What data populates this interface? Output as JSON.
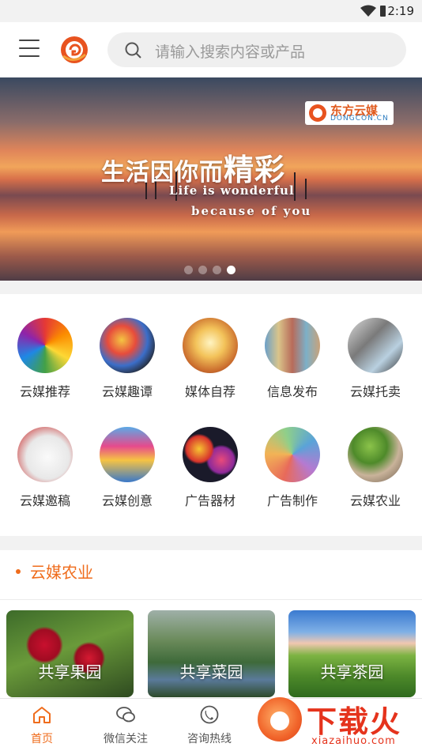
{
  "status": {
    "time": "2:19"
  },
  "search": {
    "placeholder": "请输入搜索内容或产品"
  },
  "banner": {
    "brand_name": "东方云媒",
    "brand_domain": "DONGCON.CN",
    "headline_a": "生活因你而",
    "headline_b": "精彩",
    "english_1": "Life is wonderful",
    "english_2": "because of you",
    "dots": 4,
    "active_dot": 4
  },
  "categories": [
    {
      "label": "云媒推荐",
      "icon": "color-pencils-icon"
    },
    {
      "label": "云媒趣谭",
      "icon": "paint-splash-icon"
    },
    {
      "label": "媒体自荐",
      "icon": "flower-icon"
    },
    {
      "label": "信息发布",
      "icon": "poster-wall-icon"
    },
    {
      "label": "云媒托卖",
      "icon": "graffiti-icon"
    },
    {
      "label": "云媒邀稿",
      "icon": "card-design-icon"
    },
    {
      "label": "云媒创意",
      "icon": "creative-blocks-icon"
    },
    {
      "label": "广告器材",
      "icon": "lanterns-icon"
    },
    {
      "label": "广告制作",
      "icon": "color-swatch-icon"
    },
    {
      "label": "云媒农业",
      "icon": "sprout-hand-icon"
    }
  ],
  "section": {
    "title": "云媒农业",
    "cards": [
      {
        "label": "共享果园"
      },
      {
        "label": "共享菜园"
      },
      {
        "label": "共享茶园"
      }
    ]
  },
  "tabs": [
    {
      "label": "首页",
      "icon": "home-icon",
      "active": true
    },
    {
      "label": "微信关注",
      "icon": "chat-icon",
      "active": false
    },
    {
      "label": "咨询热线",
      "icon": "phone-icon",
      "active": false
    }
  ],
  "watermark": {
    "text": "下载火",
    "sub": "xiazaihuo.com"
  },
  "colors": {
    "accent": "#ef6c1c",
    "search_bg": "#efefef"
  }
}
